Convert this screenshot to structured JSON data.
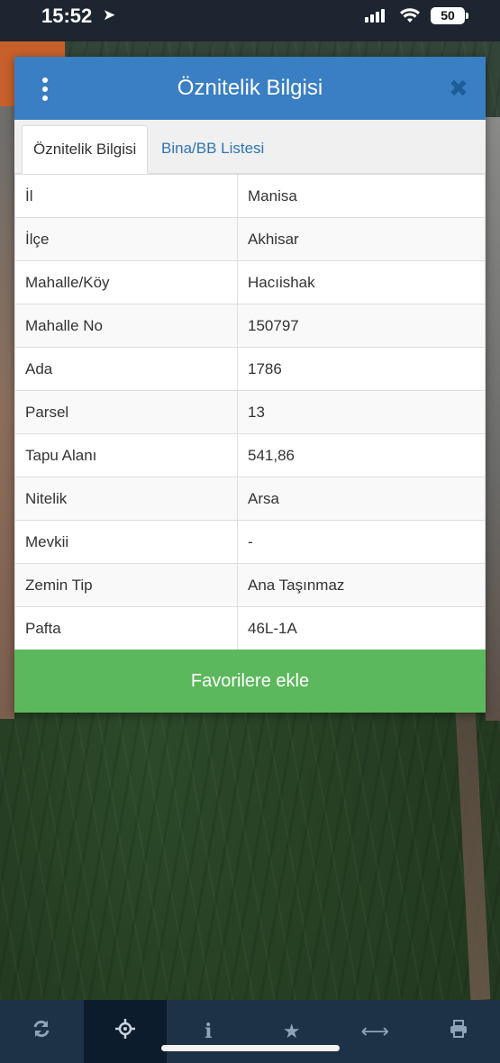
{
  "status_bar": {
    "time": "15:52",
    "battery": "50"
  },
  "modal": {
    "title": "Öznitelik Bilgisi",
    "tabs": [
      {
        "label": "Öznitelik Bilgisi",
        "active": true
      },
      {
        "label": "Bina/BB Listesi",
        "active": false
      }
    ],
    "rows": [
      {
        "key": "İl",
        "value": "Manisa"
      },
      {
        "key": "İlçe",
        "value": "Akhisar"
      },
      {
        "key": "Mahalle/Köy",
        "value": "Hacıishak"
      },
      {
        "key": "Mahalle No",
        "value": "150797"
      },
      {
        "key": "Ada",
        "value": "1786"
      },
      {
        "key": "Parsel",
        "value": "13"
      },
      {
        "key": "Tapu Alanı",
        "value": "541,86"
      },
      {
        "key": "Nitelik",
        "value": "Arsa"
      },
      {
        "key": "Mevkii",
        "value": "-"
      },
      {
        "key": "Zemin Tip",
        "value": "Ana Taşınmaz"
      },
      {
        "key": "Pafta",
        "value": "46L-1A"
      }
    ],
    "favorite_button": "Favorilere ekle"
  },
  "colors": {
    "header": "#3a7fc3",
    "favorite": "#5cb85c",
    "toolbar": "#1d3247"
  },
  "toolbar": [
    {
      "icon": "refresh-icon"
    },
    {
      "icon": "crosshair-icon",
      "active": true
    },
    {
      "icon": "info-icon"
    },
    {
      "icon": "star-icon"
    },
    {
      "icon": "measure-icon"
    },
    {
      "icon": "print-icon"
    }
  ]
}
